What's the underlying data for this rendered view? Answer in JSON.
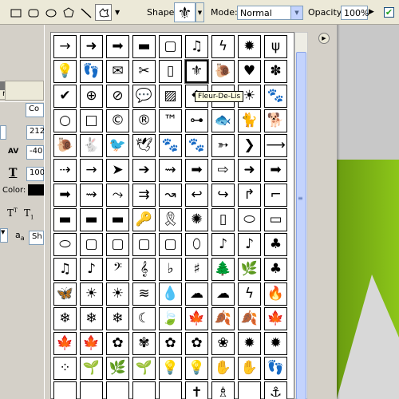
{
  "options_bar": {
    "shape_label": "Shape:",
    "shape_glyph": "⚜",
    "mode_label": "Mode:",
    "mode_value": "Normal",
    "opacity_label": "Opacity:",
    "opacity_value": "100%",
    "antialias_checked": true,
    "tool_icons": [
      "rectangle-tool-icon",
      "rounded-rectangle-tool-icon",
      "ellipse-tool-icon",
      "polygon-tool-icon",
      "line-tool-icon",
      "custom-shape-tool-icon"
    ]
  },
  "left_panel": {
    "tab_label": "raph",
    "font_size_value": "212",
    "tracking_value": "-40",
    "leading_value": "100",
    "color_label": "Color:",
    "color_swatch": "#000000",
    "font_family_partial": "Co",
    "style_partial": "Sh"
  },
  "tooltip": "Fleur-De-Lis",
  "shapes": [
    [
      "→",
      "➜",
      "➡",
      "▬",
      "▢",
      "♫",
      "ϟ",
      "✹",
      "ψ"
    ],
    [
      "💡",
      "👣",
      "✉",
      "✂",
      "▯",
      "⚜",
      "🐌",
      "♥",
      "✽"
    ],
    [
      "✔",
      "⊕",
      "⊘",
      "💬",
      "▨",
      "❖",
      "",
      "☀",
      "🐾"
    ],
    [
      "○",
      "□",
      "©",
      "®",
      "™",
      "⊶",
      "🐟",
      "🐈",
      "🐕"
    ],
    [
      "🐌",
      "🐇",
      "🐦",
      "🕊",
      "🐾",
      "🐾",
      "➳",
      "❯",
      "⟶"
    ],
    [
      "⇢",
      "→",
      "➤",
      "➔",
      "⇝",
      "➡",
      "⇨",
      "➜",
      "➡"
    ],
    [
      "➡",
      "⇝",
      "⤳",
      "⇉",
      "↝",
      "↩",
      "↪",
      "↱",
      "⌐"
    ],
    [
      "▬",
      "▬",
      "▬",
      "🔑",
      "🎗",
      "✺",
      "▯",
      "⬭",
      "▭"
    ],
    [
      "⬭",
      "▢",
      "▢",
      "▢",
      "▢",
      "⬯",
      "♪",
      "♪",
      "♣"
    ],
    [
      "♫",
      "♪",
      "𝄢",
      "𝄞",
      "♭",
      "♯",
      "🌲",
      "🌿",
      "♣"
    ],
    [
      "🦋",
      "☀",
      "☀",
      "≋",
      "💧",
      "☁",
      "☁",
      "ϟ",
      "🔥"
    ],
    [
      "❄",
      "❄",
      "❄",
      "☾",
      "🍃",
      "🍁",
      "🍂",
      "🍂",
      "🍁"
    ],
    [
      "🍁",
      "🍁",
      "✿",
      "✾",
      "✿",
      "✿",
      "❀",
      "✹",
      "✹"
    ],
    [
      "⁘",
      "🌱",
      "🌿",
      "🌱",
      "💡",
      "💡",
      "✋",
      "✋",
      "👣"
    ],
    [
      "",
      "",
      "",
      "",
      "",
      "✝",
      "♗",
      "",
      "⚓"
    ]
  ]
}
